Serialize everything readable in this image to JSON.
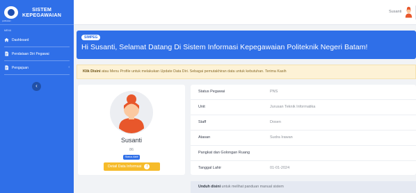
{
  "brand": {
    "title_line1": "SISTEM",
    "title_line2": "KEPEGAWAIAN",
    "logo_caption": "polibatam"
  },
  "sidebar": {
    "section_label": "MENU",
    "items": [
      {
        "label": "Dashboard",
        "icon": "home-icon"
      },
      {
        "label": "Pendataan Diri Pegawai",
        "icon": "document-icon"
      },
      {
        "label": "Pengajuan",
        "icon": "document-icon",
        "caret": "‹"
      }
    ],
    "collapse_glyph": "‹"
  },
  "topbar": {
    "username": "Susanti"
  },
  "welcome": {
    "badge": "SIMPEG",
    "heading": "Hi Susanti, Selamat Datang Di Sistem Informasi Kepegawaian Politeknik Negeri Batam!"
  },
  "notice": {
    "link": "Klik Disini",
    "text": " atau Menu Profile untuk melakukan Update Data Diri. Sebagai pemutakhiran data untuk kebutuhan. Terima Kasih"
  },
  "profile": {
    "name": "Susanti",
    "id": "86",
    "status": "Status Aktif",
    "detail_button": "Detail Data Informasi",
    "info_glyph": "!"
  },
  "details": [
    {
      "label": "Status Pegawai",
      "value": "PNS"
    },
    {
      "label": "Unit",
      "value": "Jurusan Teknik Informatika"
    },
    {
      "label": "Staff",
      "value": "Dosen"
    },
    {
      "label": "Atasan",
      "value": "Sudra Irawan"
    },
    {
      "label": "Pangkat dan Golongan Ruang",
      "value": ""
    },
    {
      "label": "Tanggal Lahir",
      "value": "01-01-2024"
    }
  ],
  "manual": {
    "link": "Unduh disini",
    "text": " untuk melihat panduan manual sistem"
  },
  "colors": {
    "primary": "#2f6fe8",
    "warning": "#f6bb2a",
    "notice_bg": "#fdf2d6",
    "avatar_hair": "#e8572b",
    "avatar_skin": "#fbc9a0"
  }
}
